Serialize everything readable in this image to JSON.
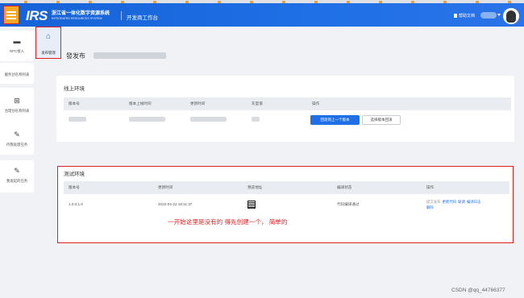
{
  "header": {
    "logo": "IRS",
    "brand_cn": "浙江省一体化数字资源系统",
    "brand_en": "INTEGRATED RESOURCES SYSTEM",
    "workbench": "开发商工作台",
    "help": "帮助文档"
  },
  "sidebar": {
    "items": [
      {
        "label": "RPC接入",
        "icon": "monitor-icon"
      },
      {
        "label": "服务创名称列表",
        "icon": "list-icon"
      },
      {
        "label": "治理创名称列表",
        "icon": "grid-icon"
      },
      {
        "label": "待我处理任务",
        "icon": "pen-icon"
      },
      {
        "label": "我发起的任务",
        "icon": "pen-icon"
      }
    ],
    "active_flyout": {
      "label": "发布管理",
      "icon": "home-icon"
    }
  },
  "page": {
    "title": "發发布"
  },
  "online": {
    "title": "线上环境",
    "headers": [
      "版本号",
      "版本上线时间",
      "更新时间",
      "灰度值",
      "操作"
    ],
    "actions": {
      "rollback": "回退到上一个版本",
      "select": "选择版本回滚"
    }
  },
  "test": {
    "title": "测试环境",
    "headers": [
      "版本号",
      "更新时间",
      "预览地址",
      "编译状态",
      "操作"
    ],
    "row": {
      "version": "1.0.0.1.0",
      "updated": "2022-04-22 16:11:37",
      "status": "代码编译通过",
      "links": [
        "提交发布",
        "更新代码",
        "联调",
        "编译日志",
        "删除"
      ]
    }
  },
  "annotation": "一开始这里是没有的 得先创建一个， 简单的",
  "watermark": "CSDN @qq_44766377",
  "colors": {
    "primary": "#1f6fe6",
    "accent": "#f5a623",
    "annotation": "#e02020"
  }
}
